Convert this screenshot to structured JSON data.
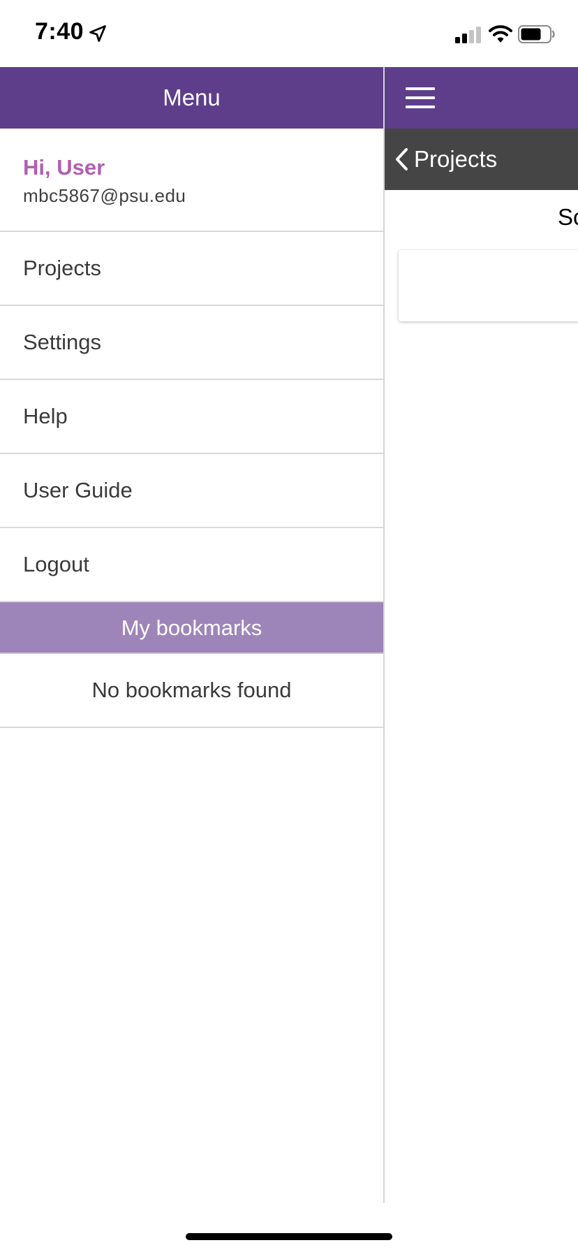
{
  "status_bar": {
    "time": "7:40",
    "icons": [
      "location-arrow-icon",
      "cellular-signal-icon",
      "wifi-icon",
      "battery-icon"
    ]
  },
  "menu": {
    "title": "Menu",
    "greeting": "Hi, User",
    "email": "mbc5867@psu.edu",
    "items": [
      {
        "label": "Projects"
      },
      {
        "label": "Settings"
      },
      {
        "label": "Help"
      },
      {
        "label": "User Guide"
      },
      {
        "label": "Logout"
      }
    ],
    "bookmarks_header": "My bookmarks",
    "bookmarks_empty": "No bookmarks found"
  },
  "main": {
    "back_label": "Projects",
    "section_title": "Sc"
  },
  "colors": {
    "header_purple": "#5e3e8b",
    "bookmarks_purple": "#9e85b9",
    "greeting_pink": "#b05fb0",
    "sub_bar_gray": "#454545"
  }
}
